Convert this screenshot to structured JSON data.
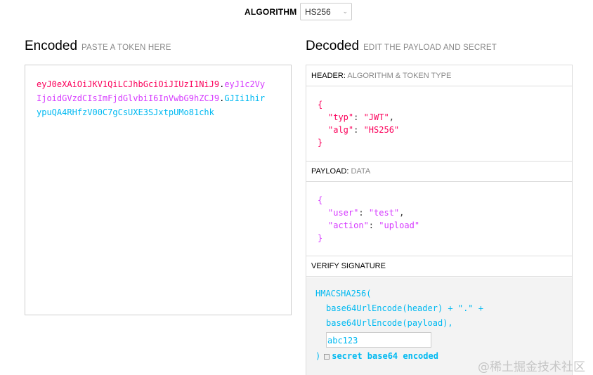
{
  "algorithm": {
    "label": "ALGORITHM",
    "selected": "HS256"
  },
  "encoded": {
    "title": "Encoded",
    "subtitle": "PASTE A TOKEN HERE",
    "token": {
      "header": "eyJ0eXAiOiJKV1QiLCJhbGciOiJIUzI1NiJ9",
      "payload": "eyJ1c2VyIjoidGVzdCIsImFjdGlvbiI6InVwbG9hZCJ9",
      "signature": "GJIi1hirypuQA4RHfzV00C7gCsUXE3SJxtpUMo81chk"
    }
  },
  "decoded": {
    "title": "Decoded",
    "subtitle": "EDIT THE PAYLOAD AND SECRET",
    "header_section": {
      "label": "HEADER:",
      "hint": "ALGORITHM & TOKEN TYPE",
      "fields": [
        {
          "key": "\"typ\"",
          "value": "\"JWT\""
        },
        {
          "key": "\"alg\"",
          "value": "\"HS256\""
        }
      ]
    },
    "payload_section": {
      "label": "PAYLOAD:",
      "hint": "DATA",
      "fields": [
        {
          "key": "\"user\"",
          "value": "\"test\""
        },
        {
          "key": "\"action\"",
          "value": "\"upload\""
        }
      ]
    },
    "verify_section": {
      "label": "VERIFY SIGNATURE",
      "line1": "HMACSHA256(",
      "line2": "base64UrlEncode(header) + \".\" +",
      "line3": "base64UrlEncode(payload),",
      "secret": "abc123",
      "close": ")",
      "checkbox_label": "secret base64 encoded"
    }
  },
  "watermark": "@稀土掘金技术社区",
  "colors": {
    "header": "#fb015b",
    "payload": "#d63aff",
    "signature": "#00b9f1"
  }
}
